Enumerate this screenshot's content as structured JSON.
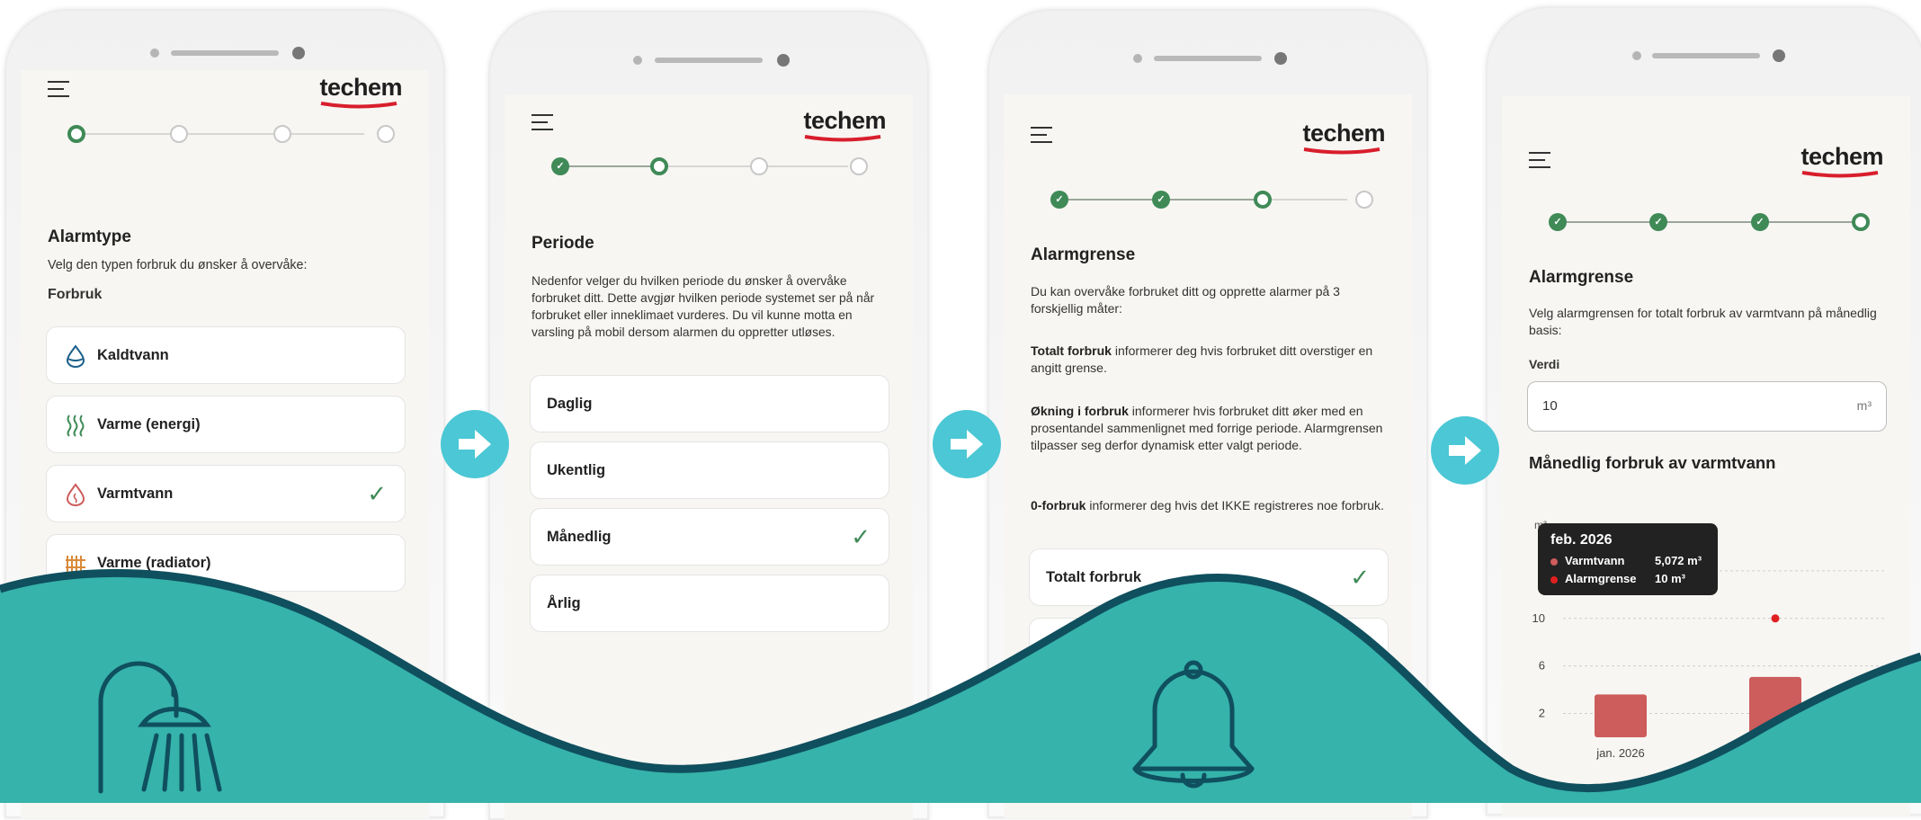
{
  "brand": {
    "logo_text": "techem",
    "accent": "#3f8a57",
    "logo_underline": "#d81e2c",
    "arrow_color": "#4bc7d5",
    "wave_color": "#36b3aa",
    "wave_outline": "#0f4f5e"
  },
  "screens": [
    {
      "title": "Alarmtype",
      "description": "Velg den typen forbruk du ønsker å overvåke:",
      "section": "Forbruk",
      "steps": [
        "active",
        "todo",
        "todo",
        "todo"
      ],
      "options": [
        {
          "label": "Kaldtvann",
          "icon": "water-drop-icon",
          "selected": false
        },
        {
          "label": "Varme (energi)",
          "icon": "heat-waves-icon",
          "selected": false
        },
        {
          "label": "Varmtvann",
          "icon": "hot-water-drop-icon",
          "selected": true
        },
        {
          "label": "Varme (radiator)",
          "icon": "radiator-icon",
          "selected": false
        }
      ]
    },
    {
      "title": "Periode",
      "description": "Nedenfor velger du hvilken periode du ønsker å overvåke forbruket ditt. Dette avgjør hvilken periode systemet ser på når forbruket eller inneklimaet vurderes. Du vil kunne motta en varsling på mobil dersom alarmen du oppretter utløses.",
      "steps": [
        "done",
        "active",
        "todo",
        "todo"
      ],
      "options": [
        {
          "label": "Daglig",
          "selected": false
        },
        {
          "label": "Ukentlig",
          "selected": false
        },
        {
          "label": "Månedlig",
          "selected": true
        },
        {
          "label": "Årlig",
          "selected": false
        }
      ]
    },
    {
      "title": "Alarmgrense",
      "intro": "Du kan overvåke forbruket ditt og opprette alarmer på 3 forskjellig måter:",
      "p1_bold": "Totalt forbruk",
      "p1_rest": " informerer deg hvis forbruket ditt overstiger en angitt grense.",
      "p2_bold": "Økning i forbruk",
      "p2_rest": " informerer hvis forbruket ditt øker med en prosentandel sammenlignet med forrige periode. Alarmgrensen tilpasser seg derfor dynamisk etter valgt periode.",
      "p3_bold": "0-forbruk",
      "p3_rest": " informerer deg hvis det IKKE registreres noe forbruk.",
      "steps": [
        "done",
        "done",
        "active",
        "todo"
      ],
      "options": [
        {
          "label": "Totalt forbruk",
          "selected": true
        }
      ]
    },
    {
      "title": "Alarmgrense",
      "description": "Velg alarmgrensen for totalt forbruk av varmtvann på månedlig basis:",
      "field_label": "Verdi",
      "field_value": "10",
      "field_unit": "m³",
      "chart_title": "Månedlig forbruk av varmtvann",
      "steps": [
        "done",
        "done",
        "done",
        "active"
      ]
    }
  ],
  "chart_data": {
    "type": "bar",
    "title": "Månedlig forbruk av varmtvann",
    "ylabel": "m³",
    "yticks": [
      2,
      6,
      10
    ],
    "ylim": [
      0,
      18
    ],
    "grid": true,
    "categories": [
      "jan. 2026",
      "feb. 2026"
    ],
    "series": [
      {
        "name": "Varmtvann",
        "values": [
          3.6,
          5.072
        ],
        "color": "#cd5c5c"
      },
      {
        "name": "Alarmgrense",
        "values": [
          null,
          10
        ],
        "color": "#e02020"
      }
    ],
    "tooltip": {
      "title": "feb. 2026",
      "rows": [
        {
          "label": "Varmtvann",
          "value": "5,072 m³"
        },
        {
          "label": "Alarmgrense",
          "value": "10 m³"
        }
      ]
    }
  },
  "decor": {
    "left_icon": "shower-icon",
    "right_icon": "bell-icon"
  }
}
